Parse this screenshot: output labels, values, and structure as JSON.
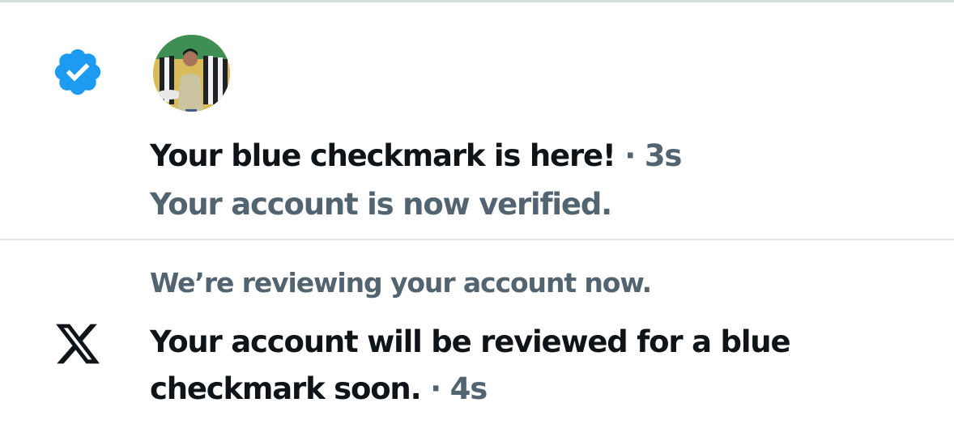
{
  "notifications": [
    {
      "icon": "verified-badge-icon",
      "icon_color": "#1d9bf0",
      "title": "Your blue checkmark is here!",
      "separator": "·",
      "time": "3s",
      "body": "Your account is now verified."
    },
    {
      "icon": "x-logo-icon",
      "icon_color": "#0f1419",
      "header": "We’re reviewing your account now.",
      "title_line1": "Your account will be reviewed for a blue",
      "title_line2": "checkmark soon.",
      "separator": "·",
      "time": "4s"
    }
  ],
  "colors": {
    "primary_text": "#0f1419",
    "secondary_text": "#536471",
    "divider": "#e4e8ea",
    "accent": "#1d9bf0"
  }
}
